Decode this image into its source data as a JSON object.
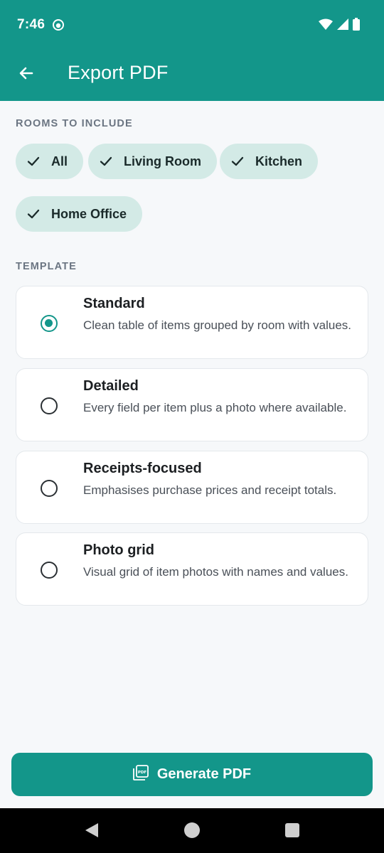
{
  "status_bar": {
    "time": "7:46",
    "icons": [
      "app-notification-icon",
      "wifi-icon",
      "cell-signal-icon",
      "battery-icon"
    ]
  },
  "app_bar": {
    "title": "Export PDF",
    "back_icon": "arrow-back-icon"
  },
  "rooms": {
    "label": "ROOMS TO INCLUDE",
    "chips": [
      {
        "label": "All",
        "selected": true
      },
      {
        "label": "Living Room",
        "selected": true
      },
      {
        "label": "Kitchen",
        "selected": true
      },
      {
        "label": "Home Office",
        "selected": true
      }
    ]
  },
  "template": {
    "label": "TEMPLATE",
    "options": [
      {
        "title": "Standard",
        "description": "Clean table of items grouped by room with values.",
        "selected": true
      },
      {
        "title": "Detailed",
        "description": "Every field per item plus a photo where available.",
        "selected": false
      },
      {
        "title": "Receipts-focused",
        "description": "Emphasises purchase prices and receipt totals.",
        "selected": false
      },
      {
        "title": "Photo grid",
        "description": "Visual grid of item photos with names and values.",
        "selected": false
      }
    ]
  },
  "generate_button": {
    "label": "Generate PDF",
    "icon": "pdf-icon"
  },
  "colors": {
    "accent": "#13968a",
    "chip_bg": "#d3eae6",
    "background": "#f6f8fa"
  }
}
